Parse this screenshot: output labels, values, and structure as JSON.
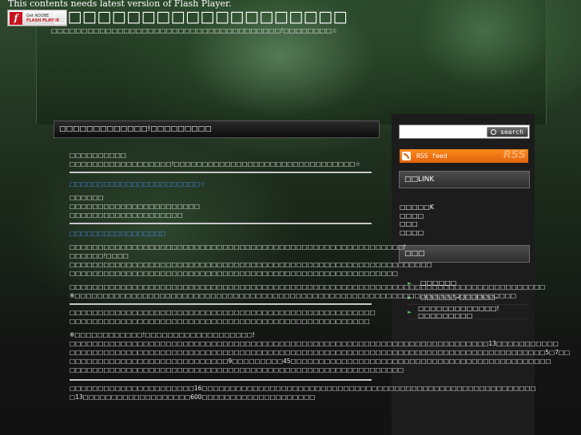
{
  "header": {
    "flash_notice": "This contents needs latest version of Flash Player.",
    "flash_badge": {
      "line1": "Get ADOBE",
      "line2": "FLASH PLAYER",
      "icon": "flash-icon"
    },
    "site_title": "□□□□□□□□□□□□□□□□□□□□",
    "site_subtitle": "□□□□□□□□□□□□□□□□□□□□□□□□□□□□□□□□□□□□□□!□□□□□□□□☆"
  },
  "sidebar": {
    "search": {
      "value": "",
      "button_label": "search",
      "icon": "search-icon"
    },
    "rss": {
      "label": "RSS feed",
      "watermark": "RSS",
      "icon": "rss-icon"
    },
    "link_heading": "□□LINK",
    "links": [
      "□□□□□K",
      "□□□□",
      "□□□",
      "□□□□"
    ],
    "nav_heading": "□□□",
    "nav_items": [
      "□□□□□□",
      "□□□□□□-□□□□□□-",
      "□□□□□□□□□□□□□!□□□□□□□□□"
    ]
  },
  "post": {
    "title": "□□□□□□□□□□□□□!□□□□□□□□□",
    "intro_title": "□□□□□□□□□□",
    "intro_text": "□□□□□□□□□□□□□□□□□□!□□□□□□□□□□□□□□□□□□□□□□□□□□□□□□□□☆",
    "link_1": "□□□□□□□□□□□□□□□□□□□□□□□☆",
    "sec2_title": "□□□□□□",
    "sec2_line1": "□□□□□□□□□□□□□□□□□□□□□□□",
    "sec2_line2": "□□□□□□□□□□□□□□□□□□□□",
    "link_2": "□□□□□□□□□□□□□□□□□",
    "sec3_line1": "□□□□□□□□□□□□□□□□□□□□□□□□□□□□□□□□□□□□□□□□□□□□□□□□□□□□□□□□□□□!□□□□□□!□□□□",
    "sec3_line2": "□□□□□□□□□□□□□□□□□□□□□□□□□□□□□□□□□□□□□□□□□□□□□□□□□□□□□□□□□□□□□□□□",
    "sec3_line3": "□□□□□□□□□□□□□□□□□□□□□□□□□□□□□□□□□□□□□□□□□□□□□□□□□□□□□□□□□□",
    "sec3_line4": "□□□□□□□□□□□□□□□□□□□□□□□□□□□□□□□□□□□□□□□□□□□□□□□□□□□□□□□□□□□□□□□□□□□□□□□□□□□□□□□□□□□□",
    "sec3_line5": "※□□□□□□□□□□□□□□□□□□□□□□□□□□□□□□□□□□□□□□□□□□□□□□□□□□□□□□□□□□□□□□□□□□□□□□□□□□□□□□",
    "sec4_line1": "□□□□□□□□□□□□□□□□□□□□□□□□□□□□□□□□□□□□□□□□□□□□□□□□□□□□□□",
    "sec4_line2": "□□□□□□□□□□□□□□□□□□□□□□□□□□□□□□□□□□□□□□□□□□□□□□□□□□□□□",
    "sec5_line1": "※□□□□□□□□□□□□!□□□□□□□□□□□□□□□□□□□!",
    "sec5_line2": "□□□□□□□□□□□□□□□□□□□□□□□□□□□□□□□□□□□□□□□□□□□□□□□□□□□□□□□□□□□□□□□□□□□□□□□□□□13□□□□□□□□□□□",
    "sec5_line3": "□□□□□□□□□□□□□□□□□□□□□□□□□□□□□□□□□□□□□□□□□□□□□□□□□□□□□□□□□□□□□□□□□□□□□□□□□□□□□□□□□□□□5□7□□",
    "sec5_line4": "□□□□□□□□□□□□□□□□□□□□□□□□□□□□9□□□□□□□□□45□□□□□□□□□□□□□□□□□□□□□□□□□□□□□□□□□□□□□□□□□□□□□□",
    "sec5_line5": "□□□□□□□□□□□□□□□□□□□□□□□□□□□□□□□□□□□□□□□□□□□□□□□□□□□□□□□□□□□",
    "sec6_line1": "□□□□□□□□□□□□□□□□□□□□□□16□□□□□□□□□□□□□□□□□□□□□□□□□□□□□□□□□□□□□□□□□□□□□□□□□□□□□□□□□□□",
    "sec6_line2": "□13□□□□□□□□□□□□□□□□□□□600□□□□□□□□□□□□□□□□□□□□"
  }
}
